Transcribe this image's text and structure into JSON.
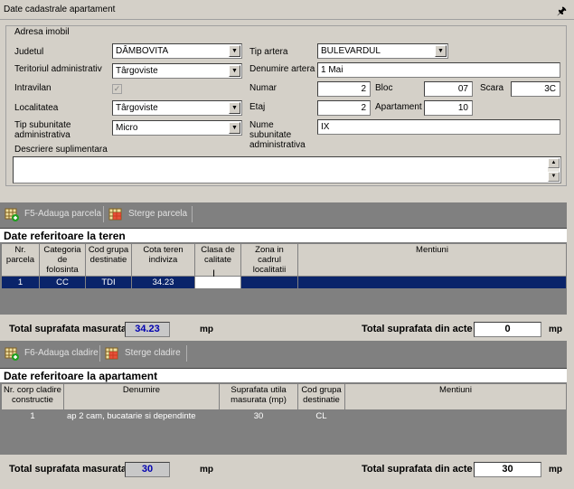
{
  "window": {
    "title": "Date cadastrale apartament"
  },
  "group": {
    "legend": "Adresa imobil"
  },
  "labels": {
    "judetul": "Judetul",
    "teritoriul": "Teritoriul administrativ",
    "intravilan": "Intravilan",
    "localitatea": "Localitatea",
    "tip_subunitate": "Tip subunitate administrativa",
    "descriere": "Descriere suplimentara",
    "tip_artera": "Tip artera",
    "denumire_artera": "Denumire artera",
    "numar": "Numar",
    "bloc": "Bloc",
    "scara": "Scara",
    "etaj": "Etaj",
    "apartament": "Apartament",
    "nume_subunitate": "Nume subunitate administrativa"
  },
  "values": {
    "judetul": "DÂMBOVITA",
    "teritoriul": "Târgoviste",
    "localitatea": "Târgoviste",
    "tip_subunitate": "Micro",
    "tip_artera": "BULEVARDUL",
    "denumire_artera": "1 Mai",
    "numar": "2",
    "bloc": "07",
    "scara": "3C",
    "etaj": "2",
    "apartament": "10",
    "nume_subunitate": "IX",
    "descriere": "",
    "intravilan_checked": true
  },
  "teren_toolbar": {
    "add": "F5-Adauga parcela",
    "delete": "Sterge parcela"
  },
  "teren": {
    "title": "Date referitoare la teren",
    "headers": [
      "Nr. parcela",
      "Categoria de folosinta",
      "Cod grupa destinatie",
      "Cota teren indiviza",
      "Clasa de calitate",
      "Zona in cadrul localitatii",
      "Mentiuni"
    ],
    "rows": [
      [
        "1",
        "CC",
        "TDI",
        "34.23",
        "",
        "",
        ""
      ]
    ],
    "total_masurata_label": "Total suprafata masurata",
    "total_masurata": "34.23",
    "total_acte_label": "Total suprafata din acte",
    "total_acte": "0",
    "unit": "mp"
  },
  "cladire_toolbar": {
    "add": "F6-Adauga cladire",
    "delete": "Sterge cladire"
  },
  "apartament": {
    "title": "Date referitoare la apartament",
    "headers": [
      "Nr. corp cladire constructie",
      "Denumire",
      "Suprafata utila masurata (mp)",
      "Cod grupa destinatie",
      "Mentiuni"
    ],
    "rows": [
      [
        "1",
        "ap 2 cam, bucatarie si dependinte",
        "30",
        "CL",
        ""
      ]
    ],
    "total_masurata_label": "Total suprafata masurata",
    "total_masurata": "30",
    "total_acte_label": "Total suprafata din acte",
    "total_acte": "30",
    "unit": "mp"
  }
}
